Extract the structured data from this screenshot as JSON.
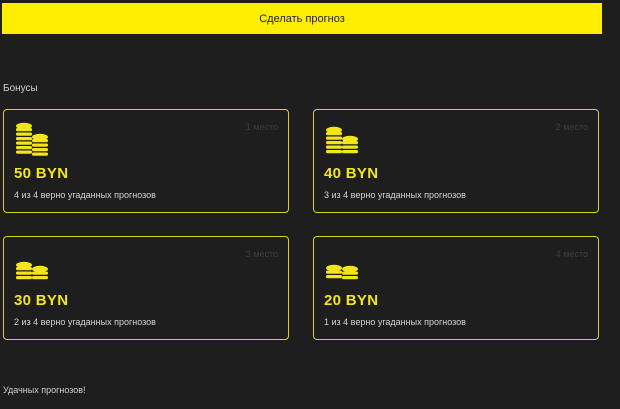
{
  "cta": {
    "label": "Сделать прогноз"
  },
  "bonuses": {
    "title": "Бонусы",
    "cards": [
      {
        "place": "1 место",
        "amount": "50 BYN",
        "description": "4 из 4 верно угаданных прогнозов",
        "icon": "coin-stack-icon"
      },
      {
        "place": "2 место",
        "amount": "40 BYN",
        "description": "3 из 4 верно угаданных прогнозов",
        "icon": "coin-stack-icon"
      },
      {
        "place": "3 место",
        "amount": "30 BYN",
        "description": "2 из 4 верно угаданных прогнозов",
        "icon": "coin-stack-small-icon"
      },
      {
        "place": "4 место",
        "amount": "20 BYN",
        "description": "1 из 4 верно угаданных прогнозов",
        "icon": "coin-stack-small-icon"
      }
    ]
  },
  "footer": {
    "text": "Удачных прогнозов!"
  },
  "colors": {
    "accent": "#ffee00",
    "background": "#1e1e1e",
    "card_border": "#d6d21e"
  }
}
